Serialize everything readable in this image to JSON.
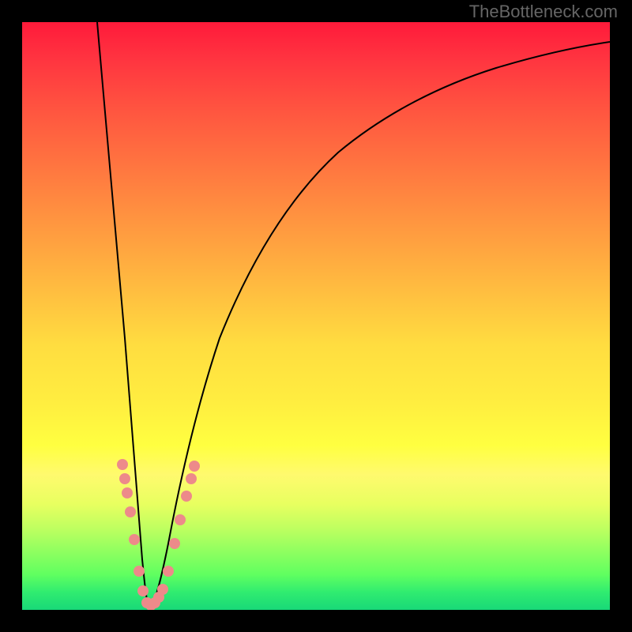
{
  "watermark": "TheBottleneck.com",
  "chart_data": {
    "type": "line",
    "title": "",
    "xlabel": "",
    "ylabel": "",
    "xlim": [
      0,
      100
    ],
    "ylim": [
      0,
      100
    ],
    "optimal_x": 20,
    "series": [
      {
        "name": "bottleneck-curve",
        "description": "V-shaped curve dipping to zero at x≈20 and rising asymptotically toward high values",
        "x": [
          12,
          14,
          16,
          18,
          19,
          20,
          21,
          22,
          24,
          28,
          35,
          45,
          60,
          80,
          100
        ],
        "y": [
          100,
          74,
          48,
          22,
          9,
          0,
          8,
          16,
          31,
          51,
          68,
          80,
          88,
          93,
          95
        ]
      }
    ],
    "markers": {
      "name": "data-points",
      "x": [
        15.5,
        16,
        16.5,
        17,
        18,
        19,
        19.5,
        20,
        20.5,
        21,
        22,
        23,
        24,
        25,
        25.5,
        26
      ],
      "y": [
        24,
        22,
        19,
        16,
        10,
        4,
        2,
        1,
        1.5,
        3,
        8,
        14,
        18,
        22,
        24,
        26
      ]
    },
    "gradient_colors": {
      "top": "#ff1a3a",
      "middle": "#ffff40",
      "bottom": "#18d878"
    }
  }
}
